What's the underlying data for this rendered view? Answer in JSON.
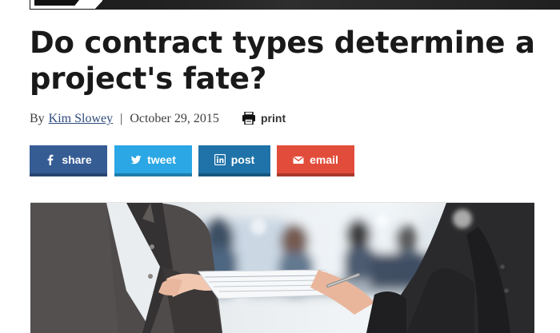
{
  "article": {
    "headline": "Do contract types determine a project's fate?",
    "byline": {
      "prefix": "By",
      "author": "Kim Slowey",
      "separator": "|",
      "date": "October 29, 2015"
    },
    "print_label": "print"
  },
  "share": {
    "buttons": [
      {
        "label": "share",
        "icon": "facebook-icon",
        "color": "#365c94"
      },
      {
        "label": "tweet",
        "icon": "twitter-icon",
        "color": "#2aa7e4"
      },
      {
        "label": "post",
        "icon": "linkedin-icon",
        "color": "#1f73a8"
      },
      {
        "label": "email",
        "icon": "envelope-icon",
        "color": "#e24d3b"
      }
    ]
  },
  "hero": {
    "description": "",
    "icon": "photo-image"
  }
}
